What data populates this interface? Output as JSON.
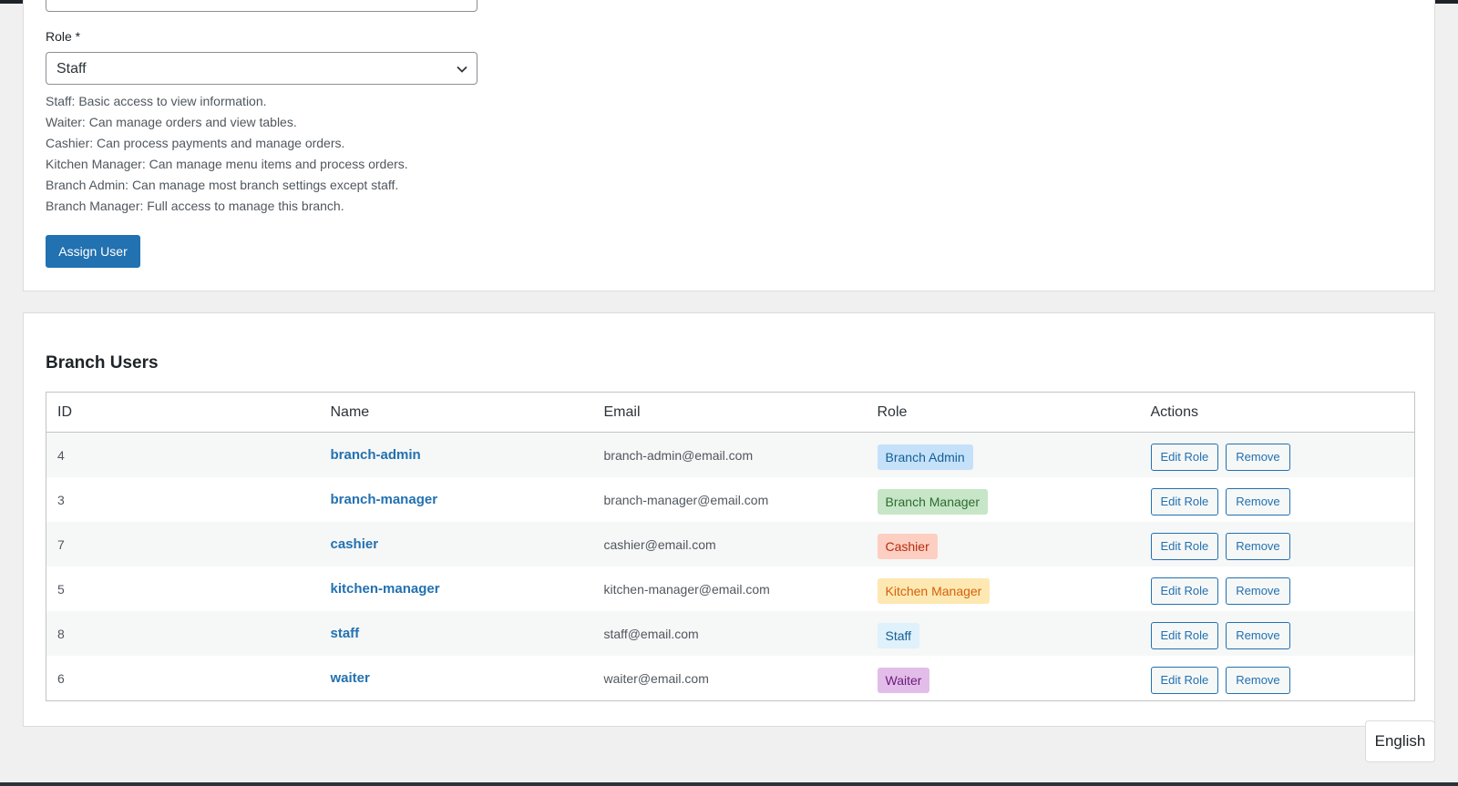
{
  "form": {
    "role_label": "Role *",
    "role_select_value": "Staff",
    "role_descriptions": [
      "Staff: Basic access to view information.",
      "Waiter: Can manage orders and view tables.",
      "Cashier: Can process payments and manage orders.",
      "Kitchen Manager: Can manage menu items and process orders.",
      "Branch Admin: Can manage most branch settings except staff.",
      "Branch Manager: Full access to manage this branch."
    ],
    "assign_button": "Assign User"
  },
  "users": {
    "title": "Branch Users",
    "columns": [
      "ID",
      "Name",
      "Email",
      "Role",
      "Actions"
    ],
    "rows": [
      {
        "id": "4",
        "name": "branch-admin",
        "email": "branch-admin@email.com",
        "role": "Branch Admin",
        "role_bg": "#c5e1fa",
        "role_fg": "#135e96"
      },
      {
        "id": "3",
        "name": "branch-manager",
        "email": "branch-manager@email.com",
        "role": "Branch Manager",
        "role_bg": "#c6e6c7",
        "role_fg": "#2e6b30"
      },
      {
        "id": "7",
        "name": "cashier",
        "email": "cashier@email.com",
        "role": "Cashier",
        "role_bg": "#fdcfc2",
        "role_fg": "#b32d0f"
      },
      {
        "id": "5",
        "name": "kitchen-manager",
        "email": "kitchen-manager@email.com",
        "role": "Kitchen Manager",
        "role_bg": "#fde8b2",
        "role_fg": "#d5600c"
      },
      {
        "id": "8",
        "name": "staff",
        "email": "staff@email.com",
        "role": "Staff",
        "role_bg": "#dff1fb",
        "role_fg": "#135e96"
      },
      {
        "id": "6",
        "name": "waiter",
        "email": "waiter@email.com",
        "role": "Waiter",
        "role_bg": "#e3bde9",
        "role_fg": "#6b1a7a"
      }
    ],
    "edit_label": "Edit Role",
    "remove_label": "Remove"
  },
  "language_button": "English",
  "colors": {
    "primary": "#2271b1",
    "background": "#f0f0f1"
  }
}
